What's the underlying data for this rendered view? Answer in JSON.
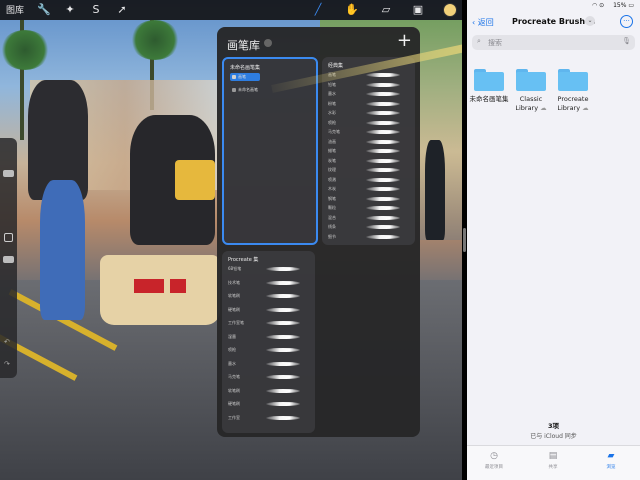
{
  "procreate": {
    "gallery_label": "图库",
    "brush_library": {
      "title": "画笔库",
      "sets": {
        "untitled": {
          "name": "未命名画笔集",
          "brushes": [
            "画笔",
            "未命名画笔"
          ]
        },
        "classic": {
          "name": "经典集",
          "brushes": [
            "画笔",
            "铅笔",
            "墨水",
            "粉笔",
            "水彩",
            "喷枪",
            "马克笔",
            "油画",
            "蜡笔",
            "炭笔",
            "纹理",
            "喷溅",
            "木炭",
            "钢笔",
            "颗粒",
            "混合",
            "线条",
            "细节"
          ]
        },
        "procreate": {
          "name": "Procreate 集",
          "brushes": [
            "6B铅笔",
            "技术笔",
            "软笔刷",
            "硬笔刷",
            "工作室笔",
            "湿墨",
            "喷枪",
            "墨水",
            "马克笔",
            "软笔刷",
            "硬笔刷",
            "工作室"
          ]
        }
      }
    },
    "colors": {
      "accent": "#3b8af0",
      "current_color": "#f2d17a"
    }
  },
  "files": {
    "status": {
      "battery": "15%"
    },
    "nav": {
      "back_label": "返回",
      "title": "Procreate Brushes"
    },
    "search": {
      "placeholder": "搜索"
    },
    "folders": [
      {
        "name": "未命名画笔集",
        "icon": "folder-icon"
      },
      {
        "name": "Classic Library",
        "icon": "folder-icon"
      },
      {
        "name": "Procreate Library",
        "icon": "folder-icon"
      }
    ],
    "footer": {
      "count": "3项",
      "sync": "已与 iCloud 同步"
    },
    "tabs": [
      {
        "label": "最近项目",
        "icon": "clock-icon"
      },
      {
        "label": "共享",
        "icon": "shared-folder-icon"
      },
      {
        "label": "浏览",
        "icon": "folder-icon"
      }
    ],
    "accent": "#1a73e8"
  }
}
